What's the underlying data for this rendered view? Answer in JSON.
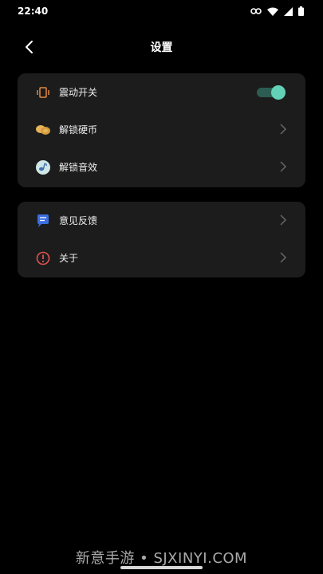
{
  "status_bar": {
    "time": "22:40",
    "icons": [
      "key-icon",
      "wifi-icon",
      "signal-icon",
      "battery-icon"
    ]
  },
  "header": {
    "title": "设置",
    "back_icon": "back-arrow-icon"
  },
  "settings": {
    "group1": [
      {
        "label": "震动开关",
        "icon": "vibrate-icon",
        "control": "toggle",
        "toggle_on": true
      },
      {
        "label": "解锁硬币",
        "icon": "coins-icon",
        "control": "chevron"
      },
      {
        "label": "解锁音效",
        "icon": "sound-effect-icon",
        "control": "chevron"
      }
    ],
    "group2": [
      {
        "label": "意见反馈",
        "icon": "feedback-icon",
        "control": "chevron"
      },
      {
        "label": "关于",
        "icon": "info-icon",
        "control": "chevron"
      }
    ]
  },
  "watermark": "新意手游 • SJXINYI.COM",
  "colors": {
    "background": "#000000",
    "card": "#1c1c1c",
    "toggle_thumb": "#63d1b5",
    "toggle_track": "#2c5d52",
    "vibrate_icon": "#e08a3c",
    "coins_icon": "#e8b45a",
    "feedback_icon": "#3b6fe0",
    "info_icon": "#e05252"
  }
}
